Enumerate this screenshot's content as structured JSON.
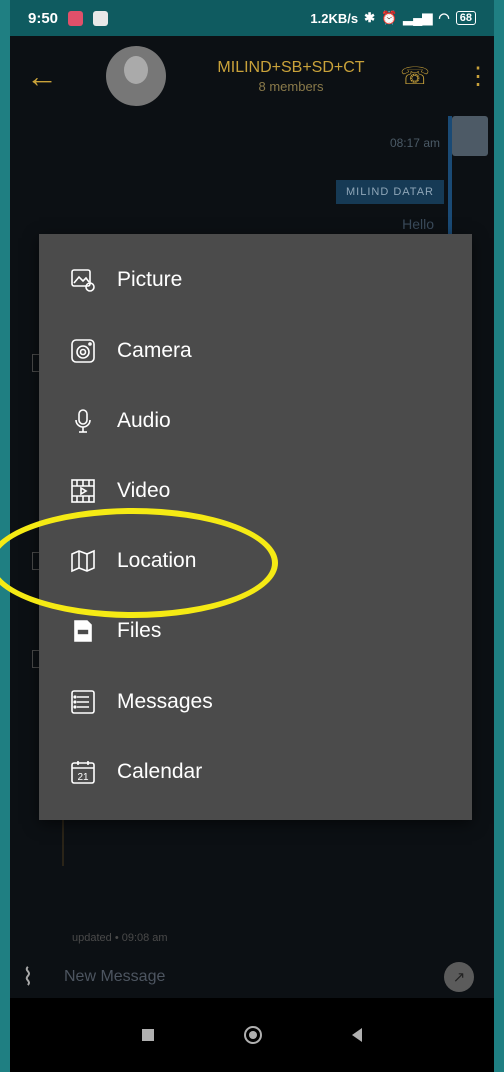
{
  "status_bar": {
    "time": "9:50",
    "network_speed": "1.2KB/s",
    "battery": "68"
  },
  "header": {
    "group_name": "MILIND+SB+SD+CT",
    "members": "8 members"
  },
  "chat": {
    "time_label": "08:17 am",
    "sender_label": "MILIND DATAR",
    "message_fragment": "Hello",
    "updated_label": "updated • 09:08 am"
  },
  "compose": {
    "placeholder": "New Message"
  },
  "attach_menu": {
    "items": [
      {
        "label": "Picture",
        "icon": "picture-icon"
      },
      {
        "label": "Camera",
        "icon": "camera-icon"
      },
      {
        "label": "Audio",
        "icon": "microphone-icon"
      },
      {
        "label": "Video",
        "icon": "video-icon"
      },
      {
        "label": "Location",
        "icon": "map-icon"
      },
      {
        "label": "Files",
        "icon": "file-icon"
      },
      {
        "label": "Messages",
        "icon": "messages-icon"
      },
      {
        "label": "Calendar",
        "icon": "calendar-icon"
      }
    ]
  },
  "colors": {
    "accent": "#c9a23a",
    "menu_bg": "#4b4b4b",
    "highlight": "#f5ea14"
  }
}
